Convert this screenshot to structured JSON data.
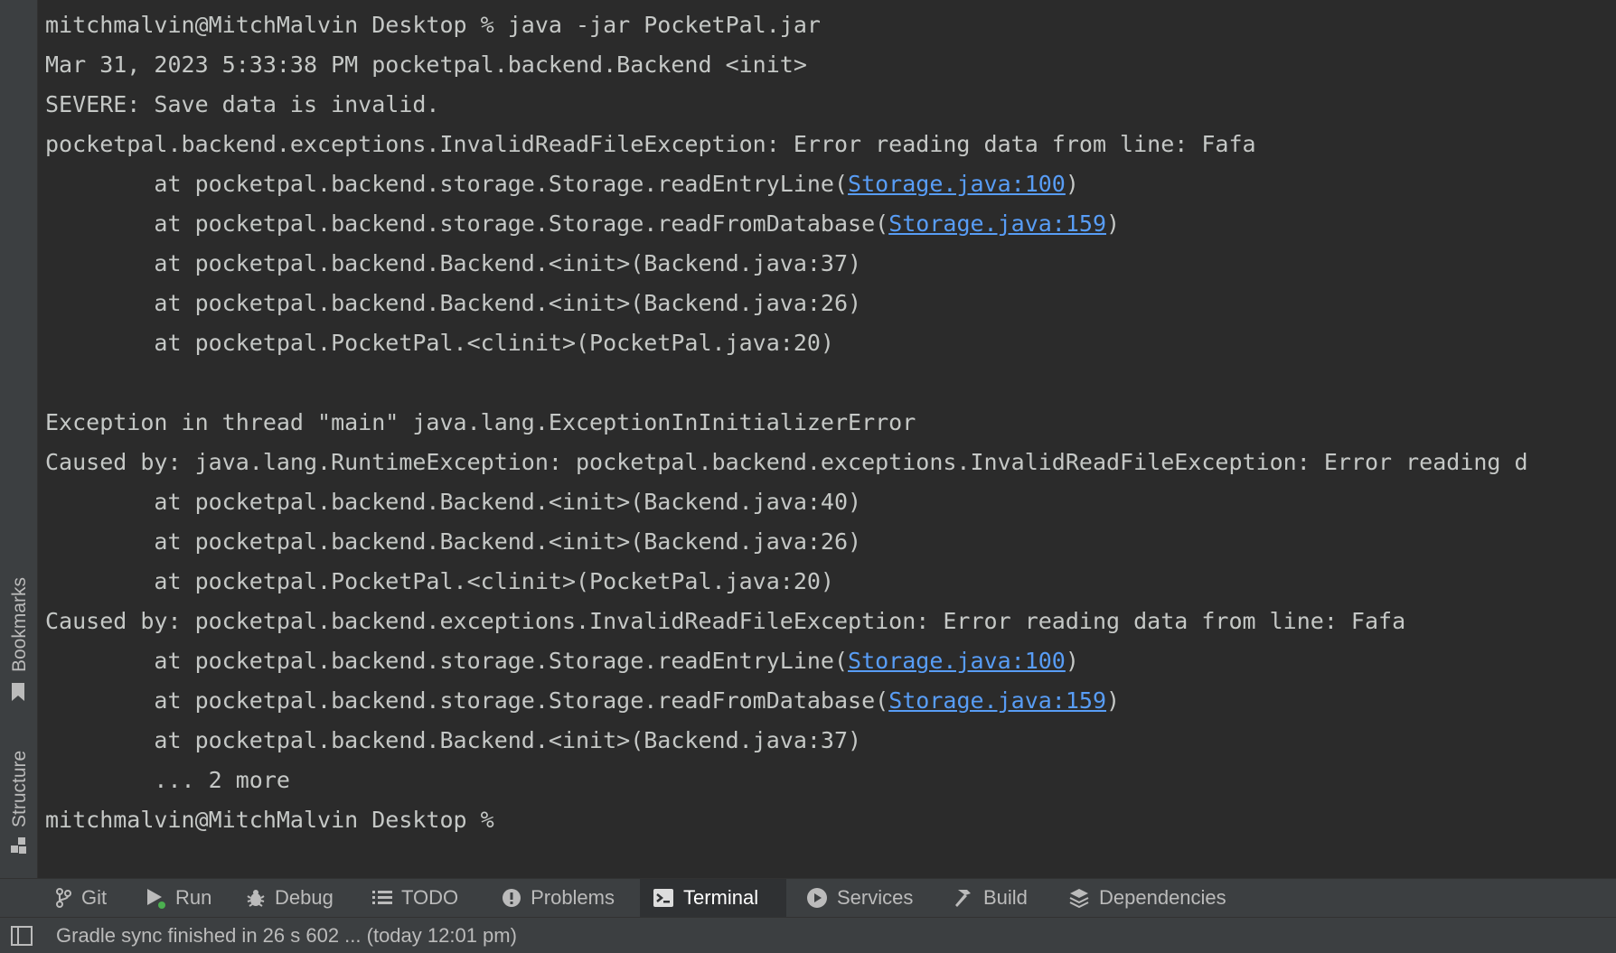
{
  "side_panel": {
    "bookmarks_label": "Bookmarks",
    "structure_label": "Structure"
  },
  "terminal": {
    "lines": [
      {
        "text": "mitchmalvin@MitchMalvin Desktop % java -jar PocketPal.jar"
      },
      {
        "text": "Mar 31, 2023 5:33:38 PM pocketpal.backend.Backend <init>"
      },
      {
        "text": "SEVERE: Save data is invalid."
      },
      {
        "text": "pocketpal.backend.exceptions.InvalidReadFileException: Error reading data from line: Fafa"
      },
      {
        "prefix": "        at pocketpal.backend.storage.Storage.readEntryLine(",
        "link": "Storage.java:100",
        "suffix": ")"
      },
      {
        "prefix": "        at pocketpal.backend.storage.Storage.readFromDatabase(",
        "link": "Storage.java:159",
        "suffix": ")"
      },
      {
        "text": "        at pocketpal.backend.Backend.<init>(Backend.java:37)"
      },
      {
        "text": "        at pocketpal.backend.Backend.<init>(Backend.java:26)"
      },
      {
        "text": "        at pocketpal.PocketPal.<clinit>(PocketPal.java:20)"
      },
      {
        "text": ""
      },
      {
        "text": "Exception in thread \"main\" java.lang.ExceptionInInitializerError"
      },
      {
        "text": "Caused by: java.lang.RuntimeException: pocketpal.backend.exceptions.InvalidReadFileException: Error reading d"
      },
      {
        "text": "        at pocketpal.backend.Backend.<init>(Backend.java:40)"
      },
      {
        "text": "        at pocketpal.backend.Backend.<init>(Backend.java:26)"
      },
      {
        "text": "        at pocketpal.PocketPal.<clinit>(PocketPal.java:20)"
      },
      {
        "text": "Caused by: pocketpal.backend.exceptions.InvalidReadFileException: Error reading data from line: Fafa"
      },
      {
        "prefix": "        at pocketpal.backend.storage.Storage.readEntryLine(",
        "link": "Storage.java:100",
        "suffix": ")"
      },
      {
        "prefix": "        at pocketpal.backend.storage.Storage.readFromDatabase(",
        "link": "Storage.java:159",
        "suffix": ")"
      },
      {
        "text": "        at pocketpal.backend.Backend.<init>(Backend.java:37)"
      },
      {
        "text": "        ... 2 more"
      },
      {
        "text": "mitchmalvin@MitchMalvin Desktop % "
      }
    ]
  },
  "toolbar": {
    "tabs": [
      {
        "label": "Git",
        "icon": "git-branch-icon"
      },
      {
        "label": "Run",
        "icon": "run-icon"
      },
      {
        "label": "Debug",
        "icon": "debug-icon"
      },
      {
        "label": "TODO",
        "icon": "todo-icon"
      },
      {
        "label": "Problems",
        "icon": "problems-icon"
      },
      {
        "label": "Terminal",
        "icon": "terminal-icon",
        "active": true
      },
      {
        "label": "Services",
        "icon": "services-icon"
      },
      {
        "label": "Build",
        "icon": "build-icon"
      },
      {
        "label": "Dependencies",
        "icon": "dependencies-icon"
      }
    ]
  },
  "status": {
    "message": "Gradle sync finished in 26 s 602 ... (today 12:01 pm)"
  },
  "colors": {
    "terminal_background": "#2b2b2b",
    "terminal_text": "#c5c8c6",
    "link": "#589df6",
    "panel_background": "#3c3f41",
    "active_tab_background": "#2f3133",
    "run_indicator": "#4caf50"
  }
}
